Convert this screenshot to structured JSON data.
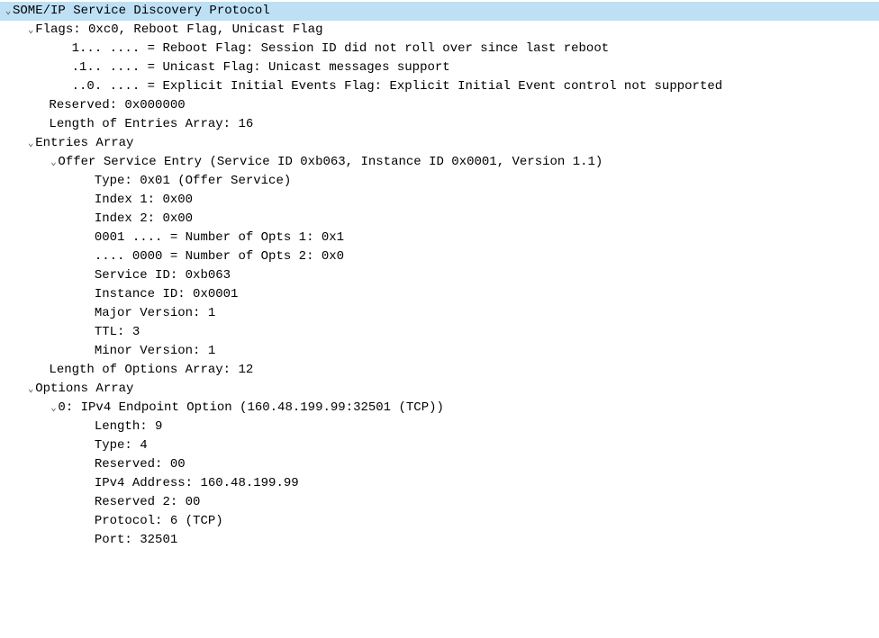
{
  "protocol_title": "SOME/IP Service Discovery Protocol",
  "flags": {
    "header": "Flags: 0xc0, Reboot Flag, Unicast Flag",
    "reboot": "1... .... = Reboot Flag: Session ID did not roll over since last reboot",
    "unicast": ".1.. .... = Unicast Flag: Unicast messages support",
    "explicit": "..0. .... = Explicit Initial Events Flag: Explicit Initial Event control not supported"
  },
  "reserved": "Reserved: 0x000000",
  "entries_len": "Length of Entries Array: 16",
  "entries": {
    "header": "Entries Array",
    "offer": {
      "header": "Offer Service Entry (Service ID 0xb063, Instance ID 0x0001, Version 1.1)",
      "type": "Type: 0x01 (Offer Service)",
      "index1": "Index 1: 0x00",
      "index2": "Index 2: 0x00",
      "nopts1": "0001 .... = Number of Opts 1: 0x1",
      "nopts2": ".... 0000 = Number of Opts 2: 0x0",
      "service_id": "Service ID: 0xb063",
      "instance_id": "Instance ID: 0x0001",
      "major": "Major Version: 1",
      "ttl": "TTL: 3",
      "minor": "Minor Version: 1"
    }
  },
  "options_len": "Length of Options Array: 12",
  "options": {
    "header": "Options Array",
    "opt0": {
      "header": "0: IPv4 Endpoint Option (160.48.199.99:32501 (TCP))",
      "length": "Length: 9",
      "type": "Type: 4",
      "reserved": "Reserved: 00",
      "ipv4": "IPv4 Address: 160.48.199.99",
      "reserved2": "Reserved 2: 00",
      "protocol": "Protocol: 6 (TCP)",
      "port": "Port: 32501"
    }
  }
}
